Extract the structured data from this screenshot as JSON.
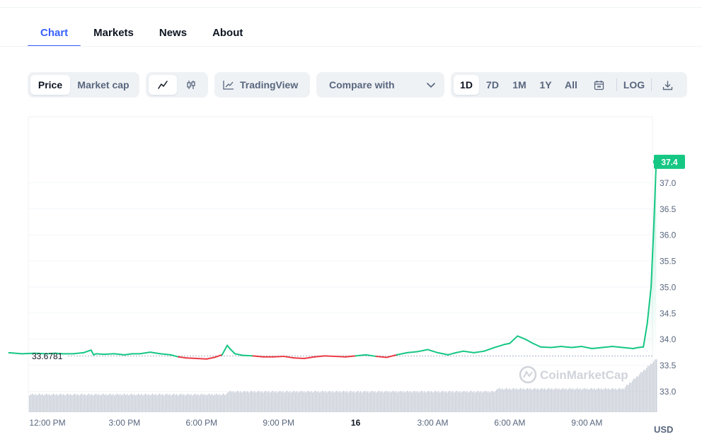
{
  "tabs": [
    {
      "label": "Chart",
      "active": true
    },
    {
      "label": "Markets",
      "active": false
    },
    {
      "label": "News",
      "active": false
    },
    {
      "label": "About",
      "active": false
    }
  ],
  "toolbar": {
    "metric": [
      {
        "label": "Price",
        "active": true
      },
      {
        "label": "Market cap",
        "active": false
      }
    ],
    "chart_types": [
      {
        "icon": "line-chart-icon",
        "active": true
      },
      {
        "icon": "candlestick-icon",
        "active": false
      }
    ],
    "tradingview_label": "TradingView",
    "compare_label": "Compare with",
    "ranges": [
      {
        "label": "1D",
        "active": true
      },
      {
        "label": "7D",
        "active": false
      },
      {
        "label": "1M",
        "active": false
      },
      {
        "label": "1Y",
        "active": false
      },
      {
        "label": "All",
        "active": false
      }
    ],
    "log_label": "LOG"
  },
  "chart_data": {
    "type": "line",
    "currency": "USD",
    "watermark": "CoinMarketCap",
    "reference_price": 33.6781,
    "reference_label": "33.6781",
    "current_price": 37.4,
    "current_label": "37.4",
    "ylim": [
      32.6,
      37.9
    ],
    "y_ticks": [
      "37.0",
      "36.5",
      "36.0",
      "35.5",
      "35.0",
      "34.5",
      "34.0",
      "33.5",
      "33.0"
    ],
    "x_ticks": [
      "12:00 PM",
      "3:00 PM",
      "6:00 PM",
      "9:00 PM",
      "16",
      "3:00 AM",
      "6:00 AM",
      "9:00 AM"
    ],
    "x_tick_hours": [
      0,
      3,
      6,
      9,
      12,
      15,
      18,
      21
    ],
    "colors": {
      "up": "#16c784",
      "down": "#ea3943",
      "volume": "#c7ccd6",
      "label_bg": "#16c784"
    },
    "series": [
      {
        "x_hours": [
          -1.5,
          -1.0,
          -0.5,
          0.0,
          0.3,
          0.6,
          1.0,
          1.4,
          1.7,
          1.8,
          1.9,
          2.2,
          2.6,
          3.0,
          3.3,
          3.6,
          4.0,
          4.4,
          4.8,
          5.1,
          5.4,
          5.8,
          6.2,
          6.5,
          6.8,
          7.0,
          7.1,
          7.3,
          7.6,
          8.0,
          8.4,
          8.8,
          9.2,
          9.6,
          10.0,
          10.4,
          10.8,
          11.2,
          11.6,
          12.0,
          12.4,
          12.8,
          13.2,
          13.6,
          14.0,
          14.4,
          14.8,
          15.2,
          15.6,
          15.9,
          16.2,
          16.6,
          17.0,
          17.4,
          17.8,
          18.0,
          18.3,
          18.6,
          18.9,
          19.2,
          19.6,
          20.0,
          20.4,
          20.8,
          21.2,
          21.6,
          22.0,
          22.4,
          22.8,
          23.0,
          23.2,
          23.35,
          23.5,
          23.6,
          23.7
        ],
        "values": [
          33.74,
          33.72,
          33.73,
          33.72,
          33.73,
          33.72,
          33.72,
          33.74,
          33.79,
          33.7,
          33.72,
          33.71,
          33.72,
          33.7,
          33.72,
          33.72,
          33.75,
          33.72,
          33.7,
          33.66,
          33.64,
          33.63,
          33.62,
          33.65,
          33.7,
          33.88,
          33.82,
          33.72,
          33.69,
          33.68,
          33.66,
          33.66,
          33.67,
          33.64,
          33.63,
          33.66,
          33.68,
          33.67,
          33.66,
          33.68,
          33.7,
          33.67,
          33.65,
          33.7,
          33.74,
          33.76,
          33.8,
          33.74,
          33.7,
          33.74,
          33.77,
          33.74,
          33.77,
          33.84,
          33.9,
          33.92,
          34.06,
          34.0,
          33.92,
          33.85,
          33.84,
          33.86,
          33.84,
          33.86,
          33.82,
          33.84,
          33.86,
          33.84,
          33.82,
          33.84,
          33.85,
          34.3,
          35.0,
          36.1,
          37.4
        ]
      }
    ]
  }
}
